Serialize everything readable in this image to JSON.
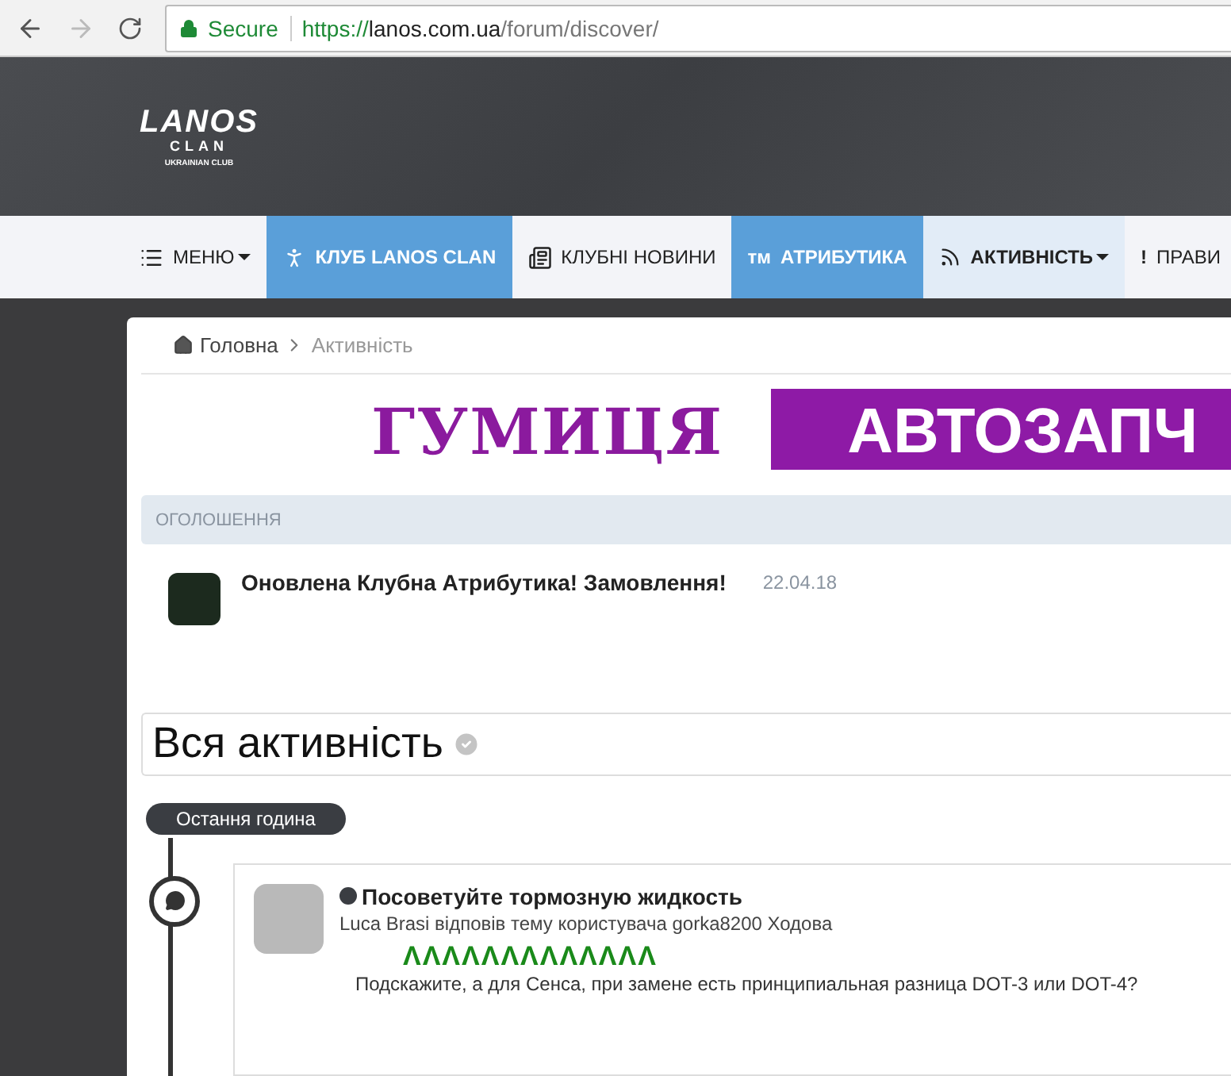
{
  "browser": {
    "secure_label": "Secure",
    "url_scheme": "https://",
    "url_host": "lanos.com.ua",
    "url_path": "/forum/discover/"
  },
  "logo": {
    "title": "LANOS",
    "subtitle": "CLAN",
    "tagline": "UKRAINIAN CLUB"
  },
  "nav": [
    {
      "label": "МЕНЮ",
      "kind": "list",
      "highlight": false,
      "selected": false,
      "dropdown": true
    },
    {
      "label": "КЛУБ LANOS CLAN",
      "kind": "person",
      "highlight": true,
      "selected": false,
      "dropdown": false
    },
    {
      "label": "КЛУБНІ НОВИНИ",
      "kind": "newspaper",
      "highlight": false,
      "selected": false,
      "dropdown": false
    },
    {
      "label": "АТРИБУТИКА",
      "kind": "text",
      "icon_text": "тм",
      "highlight": true,
      "selected": false,
      "dropdown": false
    },
    {
      "label": "АКТИВНІСТЬ",
      "kind": "rss",
      "highlight": false,
      "selected": true,
      "dropdown": true
    },
    {
      "label": "ПРАВИ",
      "kind": "text",
      "icon_text": "!",
      "highlight": false,
      "selected": false,
      "dropdown": false
    }
  ],
  "breadcrumb": [
    {
      "label": "Головна",
      "current": false
    },
    {
      "label": "Активність",
      "current": true
    }
  ],
  "ad": {
    "brand": "ГУМИЦЯ",
    "banner": "АВТОЗАПЧ"
  },
  "announcements": {
    "heading": "ОГОЛОШЕННЯ",
    "items": [
      {
        "title": "Оновлена Клубна Атрибутика! Замовлення!",
        "date": "22.04.18"
      }
    ]
  },
  "page_title": "Вся активність",
  "timeline": {
    "period": "Остання година",
    "items": [
      {
        "title": "Посоветуйте тормозную жидкость",
        "summary": "Luca Brasi відповів тему користувача gorka8200 Ходова",
        "marks": "ΛΛΛΛΛΛΛΛΛΛΛΛΛ",
        "excerpt": "Подскажите, а для Сенса, при замене есть принципиальная разница DOT-3 или DOT-4?"
      }
    ]
  }
}
